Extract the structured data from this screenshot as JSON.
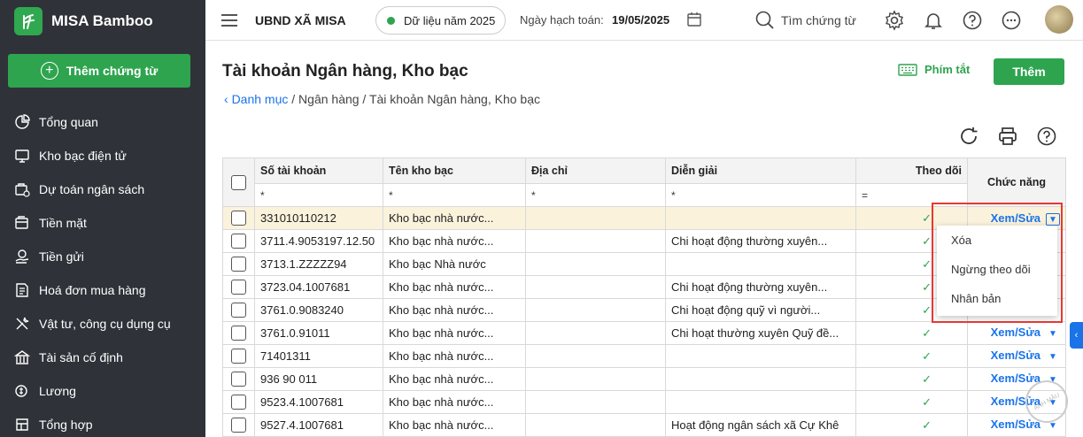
{
  "app": {
    "name": "MISA Bamboo",
    "add_voucher_label": "Thêm chứng từ"
  },
  "nav": [
    {
      "label": "Tổng quan",
      "icon": "pie-chart-icon"
    },
    {
      "label": "Kho bạc điện tử",
      "icon": "monitor-icon"
    },
    {
      "label": "Dự toán ngân sách",
      "icon": "budget-icon"
    },
    {
      "label": "Tiền mặt",
      "icon": "cash-icon"
    },
    {
      "label": "Tiền gửi",
      "icon": "deposit-icon"
    },
    {
      "label": "Hoá đơn mua hàng",
      "icon": "invoice-icon"
    },
    {
      "label": "Vật tư, công cụ dụng cụ",
      "icon": "tools-icon"
    },
    {
      "label": "Tài sản cố định",
      "icon": "asset-icon"
    },
    {
      "label": "Lương",
      "icon": "salary-icon"
    },
    {
      "label": "Tổng hợp",
      "icon": "summary-icon"
    }
  ],
  "header": {
    "org": "UBND XÃ MISA",
    "year_label": "Dữ liệu năm 2025",
    "date_label": "Ngày hạch toán:",
    "date_value": "19/05/2025",
    "search_label": "Tìm chứng từ"
  },
  "page": {
    "title": "Tài khoản Ngân hàng, Kho bạc",
    "breadcrumb_link": "Danh mục",
    "breadcrumb_rest": " / Ngân hàng / Tài khoản Ngân hàng, Kho bạc",
    "shortcut_label": "Phím tắt",
    "add_label": "Thêm"
  },
  "table": {
    "columns": [
      "Số tài khoản",
      "Tên kho bạc",
      "Địa chỉ",
      "Diễn giải",
      "Theo dõi",
      "Chức năng"
    ],
    "filter_ops": [
      "*",
      "*",
      "*",
      "*",
      "="
    ],
    "action_label": "Xem/Sửa",
    "check_mark": "✓",
    "rows": [
      {
        "account": "331010110212",
        "name": "Kho bạc nhà nước...",
        "address": "",
        "desc": ""
      },
      {
        "account": "3711.4.9053197.12.50",
        "name": "Kho bạc nhà nước...",
        "address": "",
        "desc": "Chi hoạt động thường xuyên..."
      },
      {
        "account": "3713.1.ZZZZZ94",
        "name": "Kho bạc Nhà nước",
        "address": "",
        "desc": ""
      },
      {
        "account": "3723.04.1007681",
        "name": "Kho bạc nhà nước...",
        "address": "",
        "desc": "Chi hoạt động thường xuyên..."
      },
      {
        "account": "3761.0.9083240",
        "name": "Kho bạc nhà nước...",
        "address": "",
        "desc": "Chi hoạt động quỹ vì người..."
      },
      {
        "account": "3761.0.91011",
        "name": "Kho bạc nhà nước...",
        "address": "",
        "desc": "Chi hoạt thường xuyên Quỹ đề..."
      },
      {
        "account": "71401311",
        "name": "Kho bạc nhà nước...",
        "address": "",
        "desc": ""
      },
      {
        "account": "936 90 011",
        "name": "Kho bạc nhà nước...",
        "address": "",
        "desc": ""
      },
      {
        "account": "9523.4.1007681",
        "name": "Kho bạc nhà nước...",
        "address": "",
        "desc": ""
      },
      {
        "account": "9527.4.1007681",
        "name": "Kho bạc nhà nước...",
        "address": "",
        "desc": "Hoạt động ngân sách xã Cự Khê"
      }
    ]
  },
  "dropdown": [
    "Xóa",
    "Ngừng theo dõi",
    "Nhân bản"
  ],
  "side_tab_glyph": "‹",
  "watermark": "ẢNH MẪU",
  "colors": {
    "accent": "#2ea44f",
    "link": "#1a73e8",
    "sidebar": "#2f3238",
    "highlight": "#e53935",
    "selected_row": "#fbf2dc"
  }
}
